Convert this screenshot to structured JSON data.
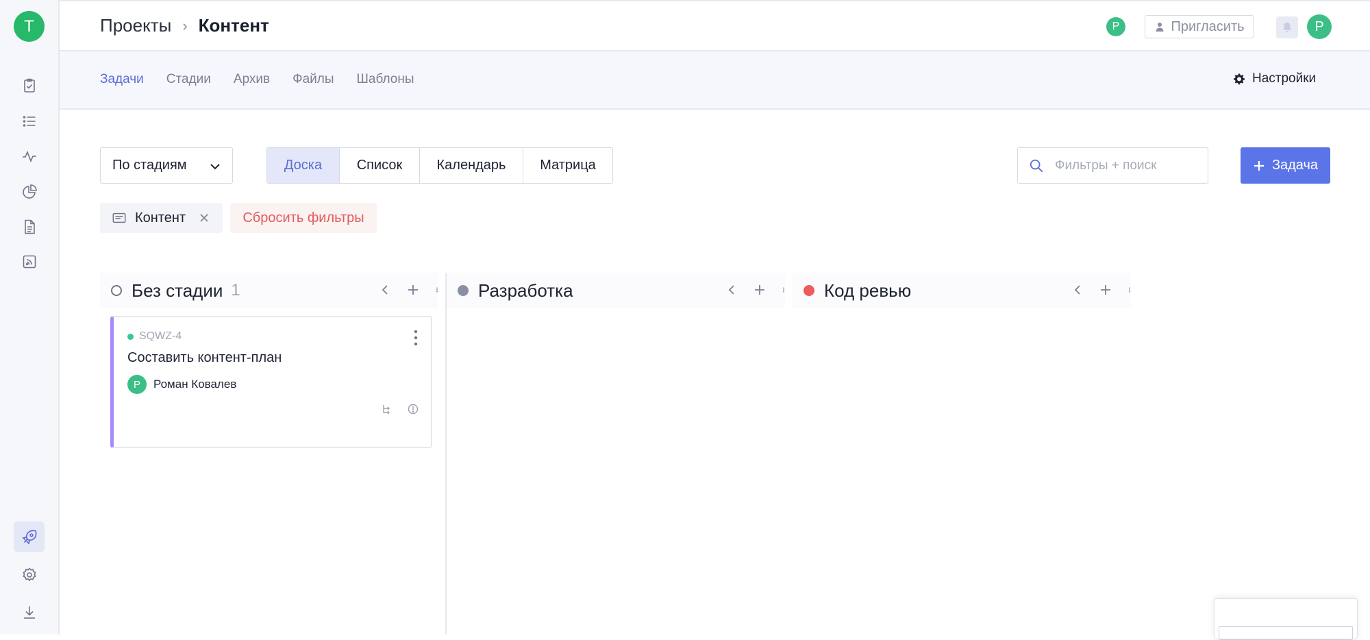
{
  "sidebar": {
    "logo_letter": "T",
    "icons": [
      "tasks-icon",
      "list-icon",
      "activity-icon",
      "chart-pie-icon",
      "document-icon",
      "feed-icon"
    ],
    "bottom_icons": [
      "rocket-icon",
      "gear-icon",
      "download-icon"
    ]
  },
  "header": {
    "breadcrumb_parent": "Проекты",
    "breadcrumb_current": "Контент",
    "user_small_initial": "Р",
    "invite_label": "Пригласить",
    "user_initial": "Р"
  },
  "subnav": {
    "tabs": [
      "Задачи",
      "Стадии",
      "Архив",
      "Файлы",
      "Шаблоны"
    ],
    "active_tab": "Задачи",
    "settings_label": "Настройки"
  },
  "toolbar": {
    "group_by": "По стадиям",
    "views": [
      "Доска",
      "Список",
      "Календарь",
      "Матрица"
    ],
    "active_view": "Доска",
    "search_placeholder": "Фильтры + поиск",
    "add_task_label": "Задача"
  },
  "filters": {
    "chip_label": "Контент",
    "reset_label": "Сбросить фильтры"
  },
  "board": {
    "columns": [
      {
        "title": "Без стадии",
        "count": "1",
        "dot_color": "",
        "dot_style": "outline"
      },
      {
        "title": "Разработка",
        "count": "",
        "dot_color": "#8a8fa3"
      },
      {
        "title": "Код ревью",
        "count": "",
        "dot_color": "#ef5a5a"
      }
    ],
    "cards": [
      {
        "id": "SQWZ-4",
        "title": "Составить контент-план",
        "assignee": "Роман Ковалев",
        "assignee_initial": "Р",
        "accent_color": "#a78bfa"
      }
    ]
  },
  "colors": {
    "accent": "#5b74e8",
    "brand_green": "#27b86a",
    "danger": "#e25b5b"
  }
}
